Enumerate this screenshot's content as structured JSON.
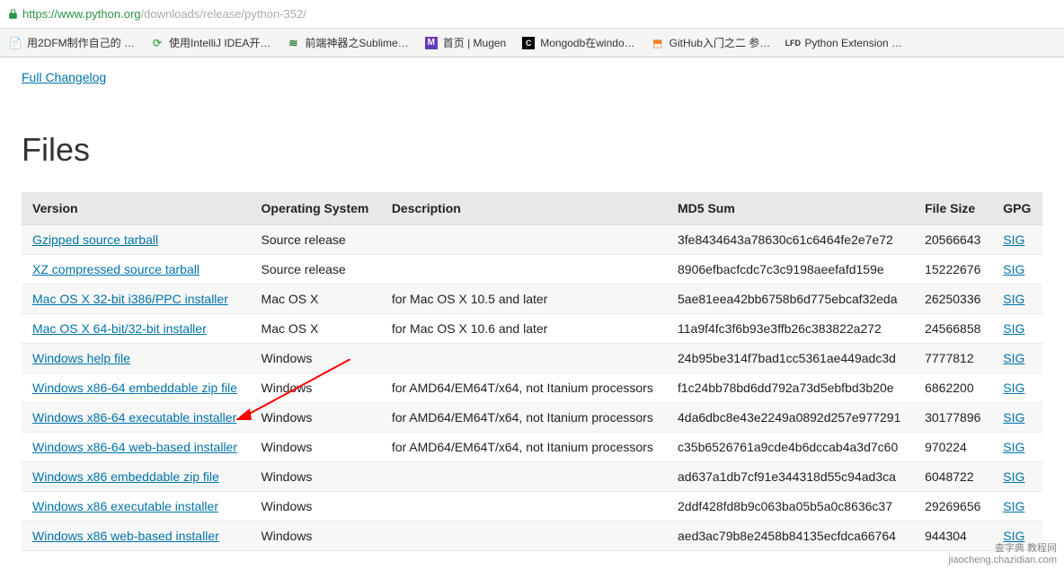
{
  "browser": {
    "url_scheme_host": "https://www.python.org",
    "url_path": "/downloads/release/python-352/",
    "bookmarks": [
      {
        "label": "用2DFM制作自己的 …",
        "icon": "page"
      },
      {
        "label": "使用IntelliJ IDEA开…",
        "icon": "refresh"
      },
      {
        "label": "前端神器之Sublime…",
        "icon": "sublime"
      },
      {
        "label": "首页 | Mugen",
        "icon": "mugen"
      },
      {
        "label": "Mongodb在windo…",
        "icon": "mongo"
      },
      {
        "label": "GitHub入门之二 参…",
        "icon": "github"
      },
      {
        "label": "Python Extension …",
        "icon": "lfd"
      }
    ]
  },
  "page": {
    "changelog_link": "Full Changelog",
    "heading": "Files",
    "table": {
      "headers": [
        "Version",
        "Operating System",
        "Description",
        "MD5 Sum",
        "File Size",
        "GPG"
      ],
      "rows": [
        {
          "version": "Gzipped source tarball",
          "os": "Source release",
          "desc": "",
          "md5": "3fe8434643a78630c61c6464fe2e7e72",
          "size": "20566643",
          "gpg": "SIG"
        },
        {
          "version": "XZ compressed source tarball",
          "os": "Source release",
          "desc": "",
          "md5": "8906efbacfcdc7c3c9198aeefafd159e",
          "size": "15222676",
          "gpg": "SIG"
        },
        {
          "version": "Mac OS X 32-bit i386/PPC installer",
          "os": "Mac OS X",
          "desc": "for Mac OS X 10.5 and later",
          "md5": "5ae81eea42bb6758b6d775ebcaf32eda",
          "size": "26250336",
          "gpg": "SIG"
        },
        {
          "version": "Mac OS X 64-bit/32-bit installer",
          "os": "Mac OS X",
          "desc": "for Mac OS X 10.6 and later",
          "md5": "11a9f4fc3f6b93e3ffb26c383822a272",
          "size": "24566858",
          "gpg": "SIG"
        },
        {
          "version": "Windows help file",
          "os": "Windows",
          "desc": "",
          "md5": "24b95be314f7bad1cc5361ae449adc3d",
          "size": "7777812",
          "gpg": "SIG"
        },
        {
          "version": "Windows x86-64 embeddable zip file",
          "os": "Windows",
          "desc": "for AMD64/EM64T/x64, not Itanium processors",
          "md5": "f1c24bb78bd6dd792a73d5ebfbd3b20e",
          "size": "6862200",
          "gpg": "SIG"
        },
        {
          "version": "Windows x86-64 executable installer",
          "os": "Windows",
          "desc": "for AMD64/EM64T/x64, not Itanium processors",
          "md5": "4da6dbc8e43e2249a0892d257e977291",
          "size": "30177896",
          "gpg": "SIG"
        },
        {
          "version": "Windows x86-64 web-based installer",
          "os": "Windows",
          "desc": "for AMD64/EM64T/x64, not Itanium processors",
          "md5": "c35b6526761a9cde4b6dccab4a3d7c60",
          "size": "970224",
          "gpg": "SIG"
        },
        {
          "version": "Windows x86 embeddable zip file",
          "os": "Windows",
          "desc": "",
          "md5": "ad637a1db7cf91e344318d55c94ad3ca",
          "size": "6048722",
          "gpg": "SIG"
        },
        {
          "version": "Windows x86 executable installer",
          "os": "Windows",
          "desc": "",
          "md5": "2ddf428fd8b9c063ba05b5a0c8636c37",
          "size": "29269656",
          "gpg": "SIG"
        },
        {
          "version": "Windows x86 web-based installer",
          "os": "Windows",
          "desc": "",
          "md5": "aed3ac79b8e2458b84135ecfdca66764",
          "size": "944304",
          "gpg": "SIG"
        }
      ]
    }
  },
  "watermark": {
    "line1": "查字典 教程网",
    "line2": "jiaocheng.chazidian.com"
  }
}
